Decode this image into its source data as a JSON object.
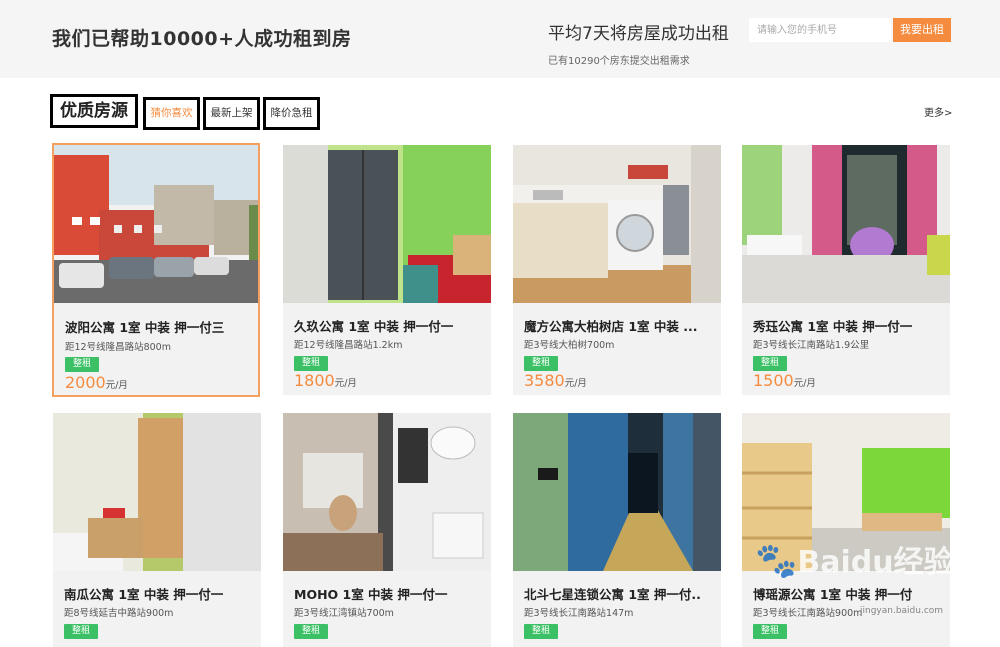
{
  "banner": {
    "title": "我们已帮助10000+人成功租到房",
    "right_title": "平均7天将房屋成功出租",
    "subtitle": "已有10290个房东提交出租需求",
    "phone_placeholder": "请输入您的手机号",
    "rent_button": "我要出租"
  },
  "section": {
    "title": "优质房源",
    "tabs": [
      {
        "label": "猜你喜欢"
      },
      {
        "label": "最新上架"
      },
      {
        "label": "降价急租"
      }
    ],
    "more": "更多>"
  },
  "listings": [
    {
      "title": "波阳公寓 1室 中装 押一付三",
      "distance": "距12号线隆昌路站800m",
      "tag": "整租",
      "price": "2000",
      "unit": "元/月"
    },
    {
      "title": "久玖公寓 1室 中装 押一付一",
      "distance": "距12号线隆昌路站1.2km",
      "tag": "整租",
      "price": "1800",
      "unit": "元/月"
    },
    {
      "title": "魔方公寓大柏树店 1室 中装 ...",
      "distance": "距3号线大柏树700m",
      "tag": "整租",
      "price": "3580",
      "unit": "元/月"
    },
    {
      "title": "秀珏公寓 1室 中装 押一付一",
      "distance": "距3号线长江南路站1.9公里",
      "tag": "整租",
      "price": "1500",
      "unit": "元/月"
    },
    {
      "title": "南瓜公寓 1室 中装 押一付一",
      "distance": "距8号线延吉中路站900m",
      "tag": "整租"
    },
    {
      "title": "MOHO 1室 中装 押一付一",
      "distance": "距3号线江湾镇站700m",
      "tag": "整租"
    },
    {
      "title": "北斗七星连锁公寓 1室 押一付..",
      "distance": "距3号线长江南路站147m",
      "tag": "整租"
    },
    {
      "title": "博瑶源公寓 1室 中装 押一付",
      "distance": "距3号线长江南路站900m",
      "tag": "整租"
    }
  ],
  "watermark": {
    "brand": "Baidu经验",
    "url": "jingyan.baidu.com"
  }
}
